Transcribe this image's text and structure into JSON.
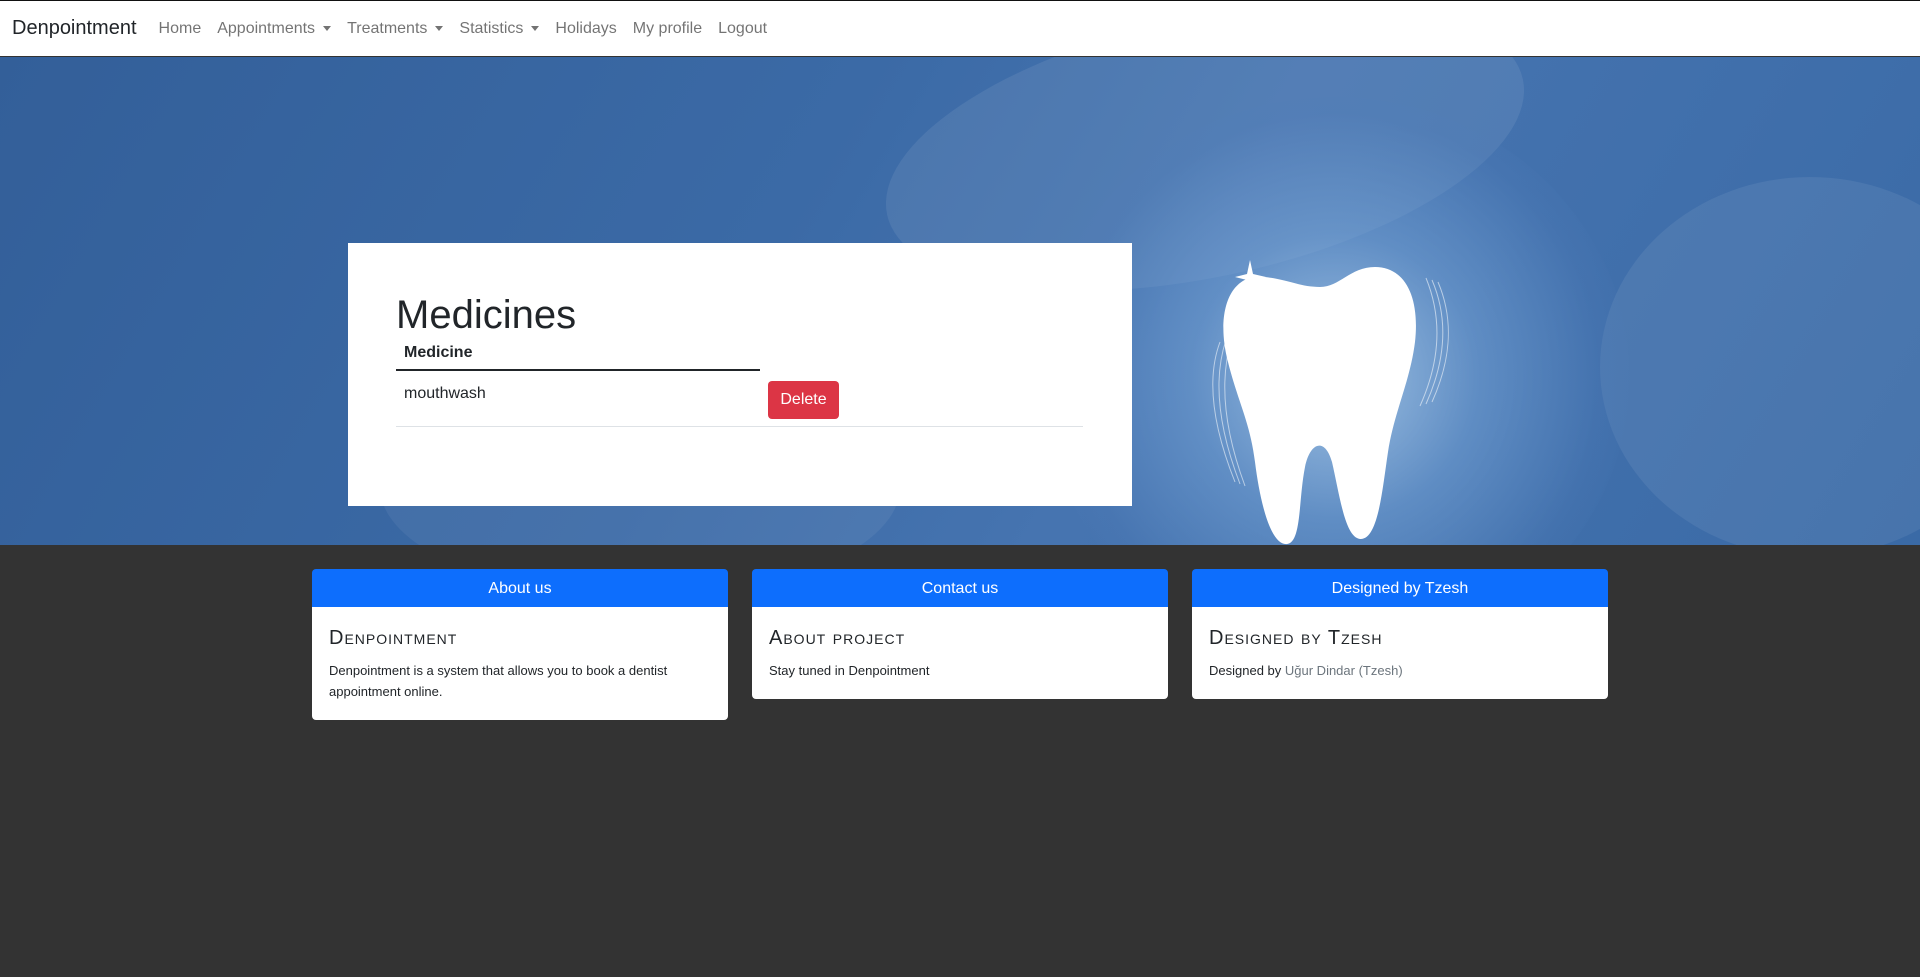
{
  "navbar": {
    "brand": "Denpointment",
    "items": [
      {
        "label": "Home",
        "dropdown": false
      },
      {
        "label": "Appointments",
        "dropdown": true
      },
      {
        "label": "Treatments",
        "dropdown": true
      },
      {
        "label": "Statistics",
        "dropdown": true
      },
      {
        "label": "Holidays",
        "dropdown": false
      },
      {
        "label": "My profile",
        "dropdown": false
      },
      {
        "label": "Logout",
        "dropdown": false
      }
    ]
  },
  "main": {
    "title": "Medicines",
    "table": {
      "header": "Medicine",
      "rows": [
        {
          "medicine": "mouthwash",
          "action": "Delete"
        }
      ]
    }
  },
  "footer": {
    "cards": [
      {
        "header": "About us",
        "title": "Denpointment",
        "text": "Denpointment is a system that allows you to book a dentist appointment online."
      },
      {
        "header": "Contact us",
        "title": "About project",
        "text": "Stay tuned in Denpointment"
      },
      {
        "header": "Designed by Tzesh",
        "title": "Designed by Tzesh",
        "text_prefix": "Designed by ",
        "text_link": "Uğur Dindar (Tzesh)"
      }
    ]
  },
  "colors": {
    "primary": "#0d6efd",
    "danger": "#dc3545",
    "hero": "#3b6aa6",
    "footer_bg": "#333333"
  }
}
